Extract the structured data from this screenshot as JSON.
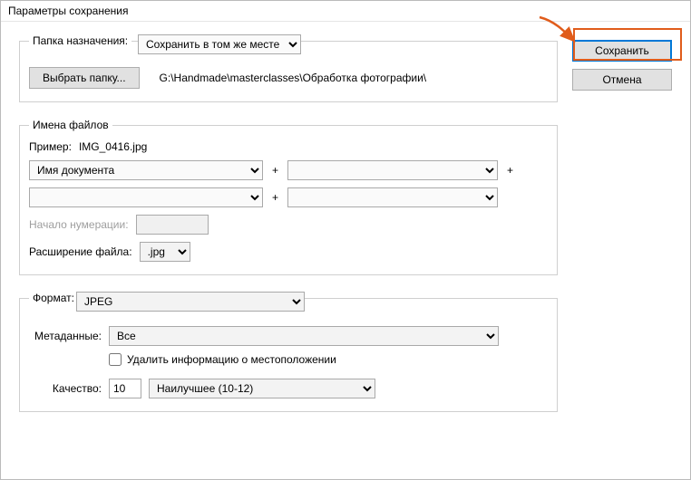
{
  "window": {
    "title": "Параметры сохранения"
  },
  "destination": {
    "legend": "Папка назначения:",
    "mode_selected": "Сохранить в том же месте",
    "choose_folder_btn": "Выбрать папку...",
    "path": "G:\\Handmade\\masterclasses\\Обработка фотографии\\"
  },
  "filenames": {
    "legend": "Имена файлов",
    "example_label": "Пример:",
    "example_value": "IMG_0416.jpg",
    "part1_selected": "Имя документа",
    "part2_selected": "",
    "part3_selected": "",
    "part4_selected": "",
    "plus": "+",
    "start_number_label": "Начало нумерации:",
    "start_number_value": "",
    "ext_label": "Расширение файла:",
    "ext_selected": ".jpg"
  },
  "format": {
    "legend": "Формат:",
    "format_selected": "JPEG",
    "metadata_label": "Метаданные:",
    "metadata_selected": "Все",
    "remove_location_label": "Удалить информацию о местоположении",
    "remove_location_checked": false,
    "quality_label": "Качество:",
    "quality_value": "10",
    "quality_preset_selected": "Наилучшее  (10-12)"
  },
  "actions": {
    "save": "Сохранить",
    "cancel": "Отмена"
  }
}
